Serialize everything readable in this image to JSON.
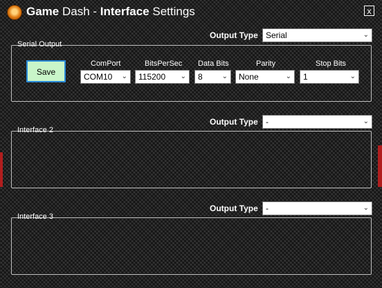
{
  "window": {
    "title_bold_1": "Game",
    "title_normal_1": " Dash - ",
    "title_bold_2": "Interface",
    "title_normal_2": " Settings",
    "close_glyph": "x"
  },
  "labels": {
    "output_type": "Output Type"
  },
  "interfaces": [
    {
      "group_title": "Serial Output",
      "output_type_value": "Serial",
      "save_label": "Save",
      "columns": {
        "comport": "ComPort",
        "bitspersec": "BitsPerSec",
        "databits": "Data Bits",
        "parity": "Parity",
        "stopbits": "Stop Bits"
      },
      "values": {
        "comport": "COM10",
        "bitspersec": "115200",
        "databits": "8",
        "parity": "None",
        "stopbits": "1"
      }
    },
    {
      "group_title": "Interface 2",
      "output_type_value": "-"
    },
    {
      "group_title": "Interface 3",
      "output_type_value": "-"
    }
  ],
  "icons": {
    "chevron": "chevron-down-icon",
    "logo": "game-dash-logo-icon",
    "close": "close-icon"
  },
  "colors": {
    "save_bg": "#c9f5c9",
    "save_border": "#2a8ad8",
    "accent_red": "#b11e1e"
  }
}
